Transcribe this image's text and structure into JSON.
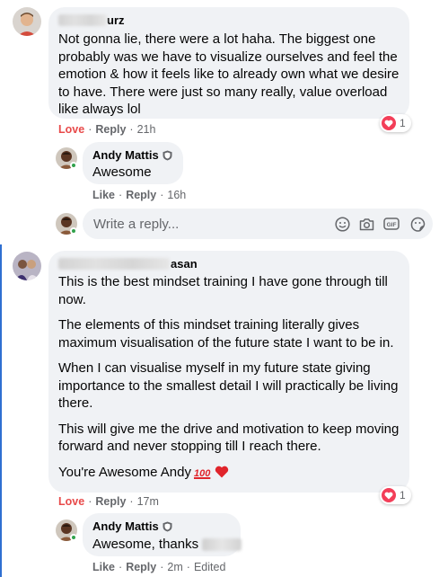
{
  "comment1": {
    "author_suffix": "urz",
    "text": "Not gonna lie, there were a lot haha. The biggest one probably was we have to visualize ourselves and feel the emotion & how it feels like to already own what we desire to have. There were just so many really, value overload like always lol",
    "love_label": "Love",
    "reply_label": "Reply",
    "time": "21h",
    "reaction_count": "1"
  },
  "reply1": {
    "author": "Andy Mattis",
    "text": "Awesome",
    "like_label": "Like",
    "reply_label": "Reply",
    "time": "16h"
  },
  "reply_box": {
    "placeholder": "Write a reply...",
    "icons": [
      "emoji-icon",
      "camera-icon",
      "gif-icon",
      "sticker-icon"
    ]
  },
  "comment2": {
    "author_suffix": "asan",
    "paragraphs": [
      "This is the best mindset training I have gone through till now.",
      "The elements of this mindset training literally gives maximum visualisation of the future state I want to be in.",
      "When I can visualise myself in my future state giving importance to the smallest detail I will practically be living there.",
      "This will give me the drive and motivation to keep moving forward and never stopping till I reach there."
    ],
    "closing": "You're Awesome Andy",
    "closing_emoji": "100",
    "love_label": "Love",
    "reply_label": "Reply",
    "time": "17m",
    "reaction_count": "1"
  },
  "reply2": {
    "author": "Andy Mattis",
    "text": "Awesome, thanks",
    "like_label": "Like",
    "reply_label": "Reply",
    "time": "2m",
    "edited": "Edited"
  },
  "colors": {
    "bubble": "#f0f2f5",
    "meta": "#65676b",
    "love": "#e84a4a",
    "heart": "#f33e58",
    "thread_line": "#2f6fd1",
    "online": "#31a24c"
  }
}
